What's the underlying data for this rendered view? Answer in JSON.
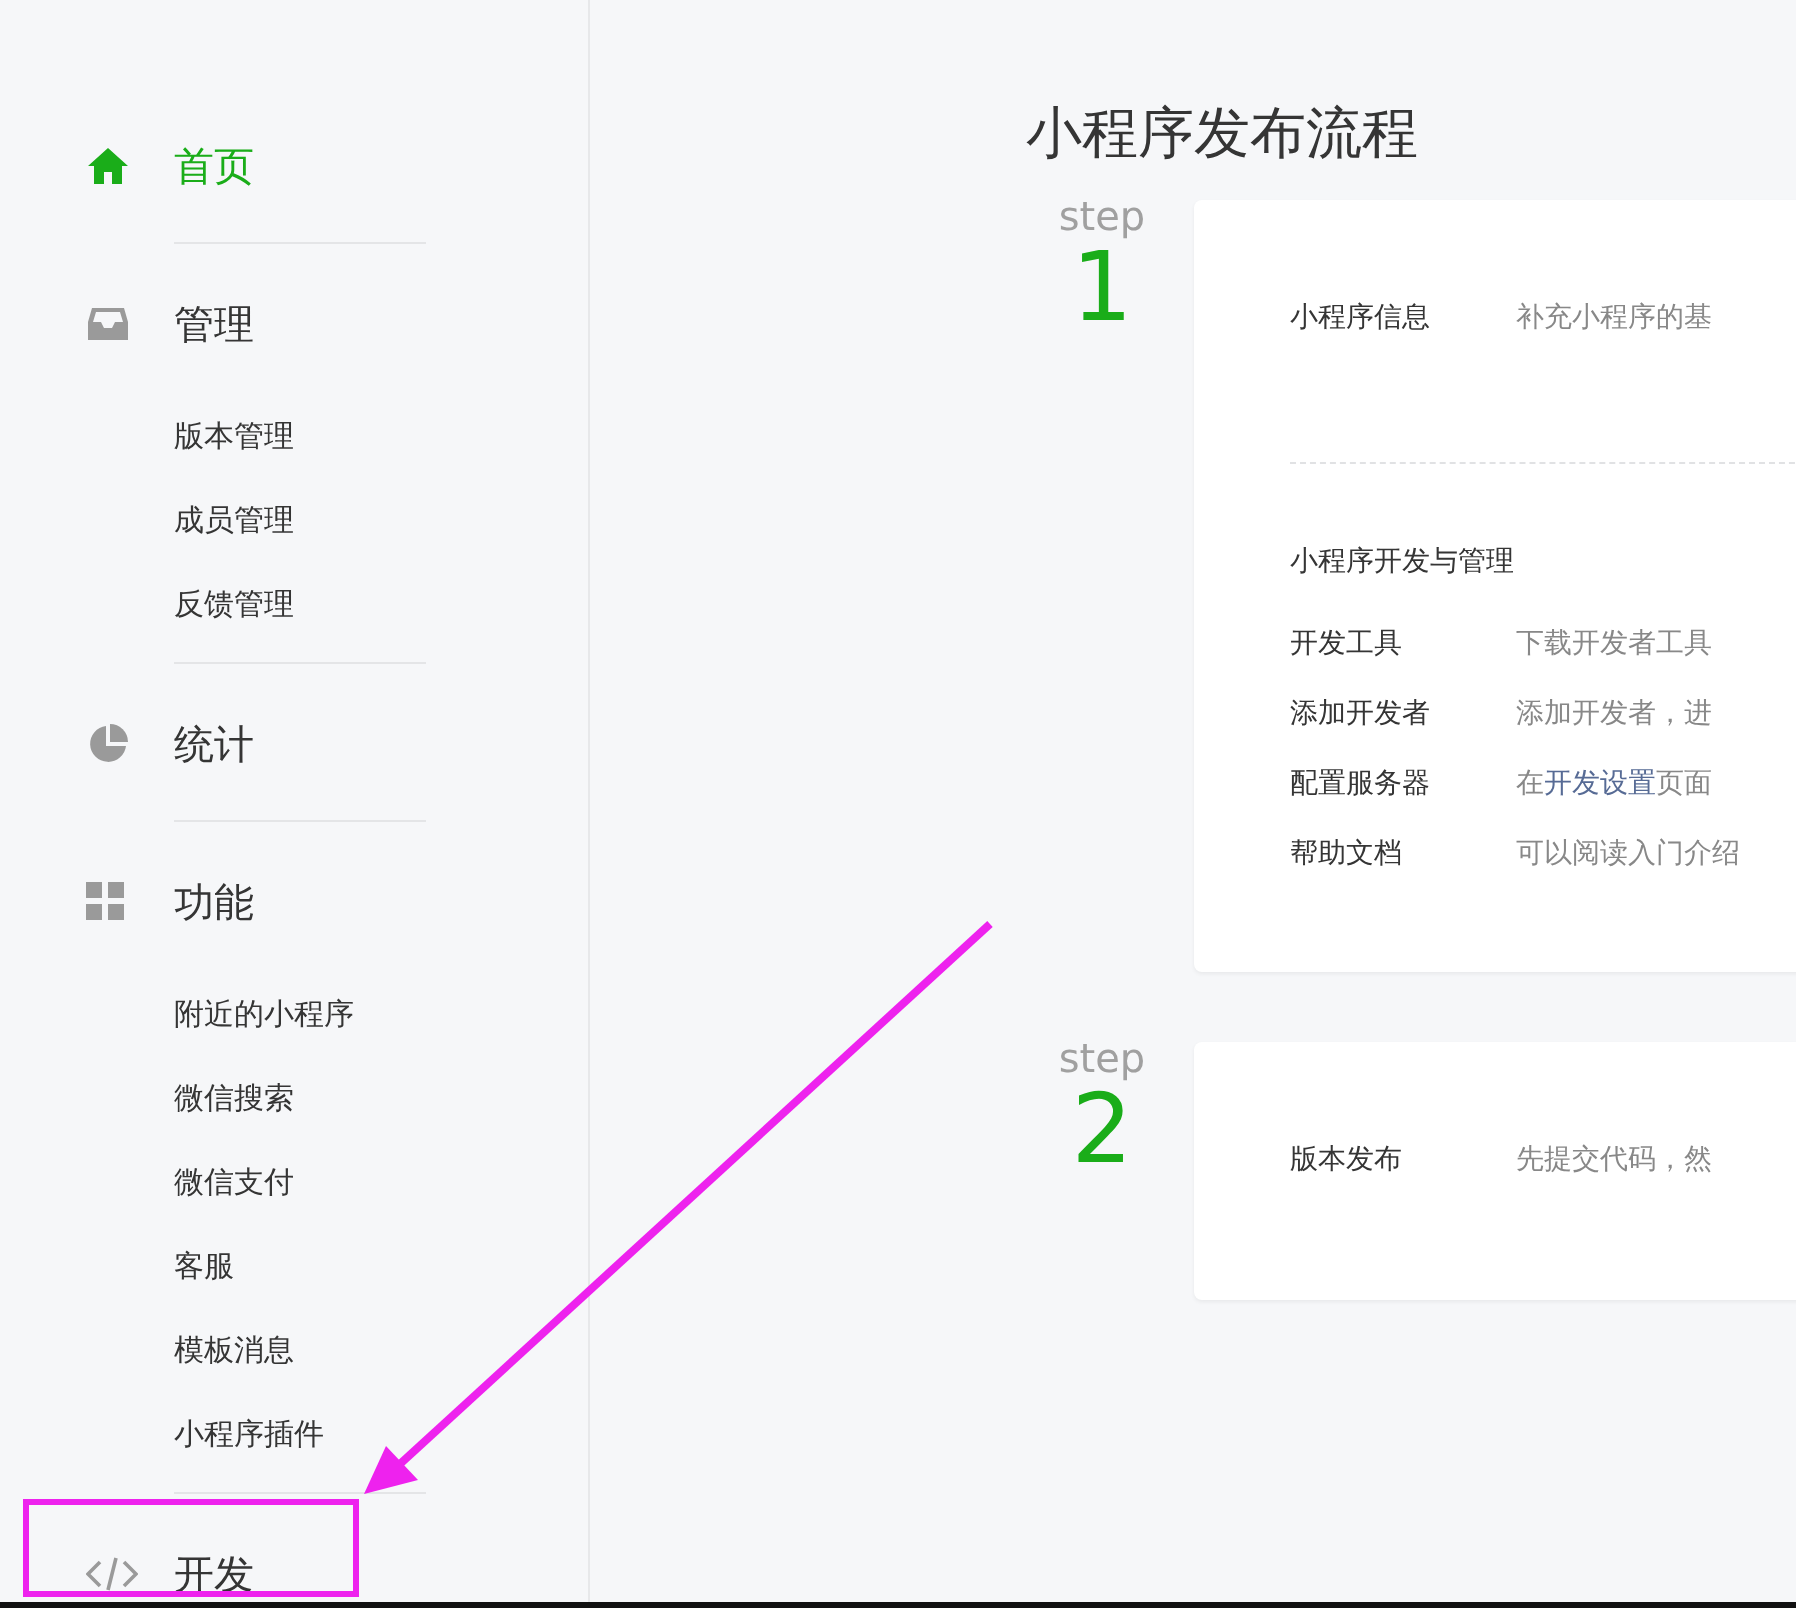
{
  "sidebar": {
    "sections": [
      {
        "label": "首页",
        "selected": true
      },
      {
        "label": "管理",
        "selected": false,
        "children": [
          {
            "label": "版本管理"
          },
          {
            "label": "成员管理"
          },
          {
            "label": "反馈管理"
          }
        ]
      },
      {
        "label": "统计",
        "selected": false
      },
      {
        "label": "功能",
        "selected": false,
        "children": [
          {
            "label": "附近的小程序"
          },
          {
            "label": "微信搜索"
          },
          {
            "label": "微信支付"
          },
          {
            "label": "客服"
          },
          {
            "label": "模板消息"
          },
          {
            "label": "小程序插件"
          }
        ]
      },
      {
        "label": "开发",
        "selected": false
      }
    ]
  },
  "main": {
    "title": "小程序发布流程",
    "steps": [
      {
        "label": "step",
        "number": "1",
        "groups": [
          {
            "rows": [
              {
                "label": "小程序信息",
                "description": [
                  {
                    "kind": "text",
                    "text": "补充小程序的基"
                  }
                ]
              }
            ]
          },
          {
            "heading": "小程序开发与管理",
            "rows": [
              {
                "label": "开发工具",
                "description": [
                  {
                    "kind": "text",
                    "text": "下载开发者工具"
                  }
                ]
              },
              {
                "label": "添加开发者",
                "description": [
                  {
                    "kind": "text",
                    "text": "添加开发者，进"
                  }
                ]
              },
              {
                "label": "配置服务器",
                "description": [
                  {
                    "kind": "text",
                    "text": "在"
                  },
                  {
                    "kind": "link",
                    "text": "开发设置"
                  },
                  {
                    "kind": "text",
                    "text": "页面"
                  }
                ]
              },
              {
                "label": "帮助文档",
                "description": [
                  {
                    "kind": "text",
                    "text": "可以阅读入门介绍"
                  }
                ]
              }
            ]
          }
        ]
      },
      {
        "label": "step",
        "number": "2",
        "groups": [
          {
            "rows": [
              {
                "label": "版本发布",
                "description": [
                  {
                    "kind": "text",
                    "text": "先提交代码，然"
                  }
                ]
              }
            ]
          }
        ]
      }
    ]
  }
}
